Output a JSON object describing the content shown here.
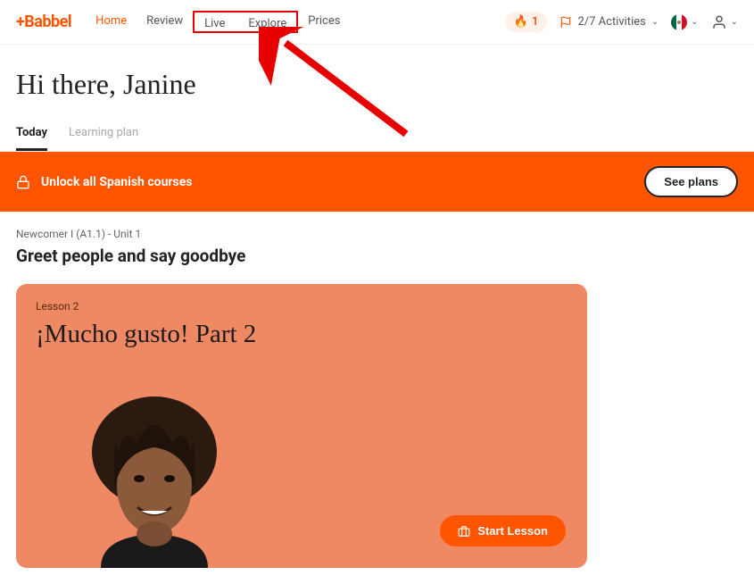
{
  "header": {
    "logo": "+Babbel",
    "nav": {
      "home": "Home",
      "review": "Review",
      "live": "Live",
      "explore": "Explore",
      "prices": "Prices"
    },
    "streak_count": "1",
    "activities_label": "2/7 Activities"
  },
  "greeting": "Hi there, Janine",
  "tabs": {
    "today": "Today",
    "learning_plan": "Learning plan"
  },
  "unlock_banner": {
    "text": "Unlock all Spanish courses",
    "button": "See plans"
  },
  "unit": {
    "label": "Newcomer I (A1.1) - Unit 1",
    "title": "Greet people and say goodbye"
  },
  "lesson": {
    "label": "Lesson 2",
    "title": "¡Mucho gusto! Part 2",
    "button": "Start Lesson"
  }
}
